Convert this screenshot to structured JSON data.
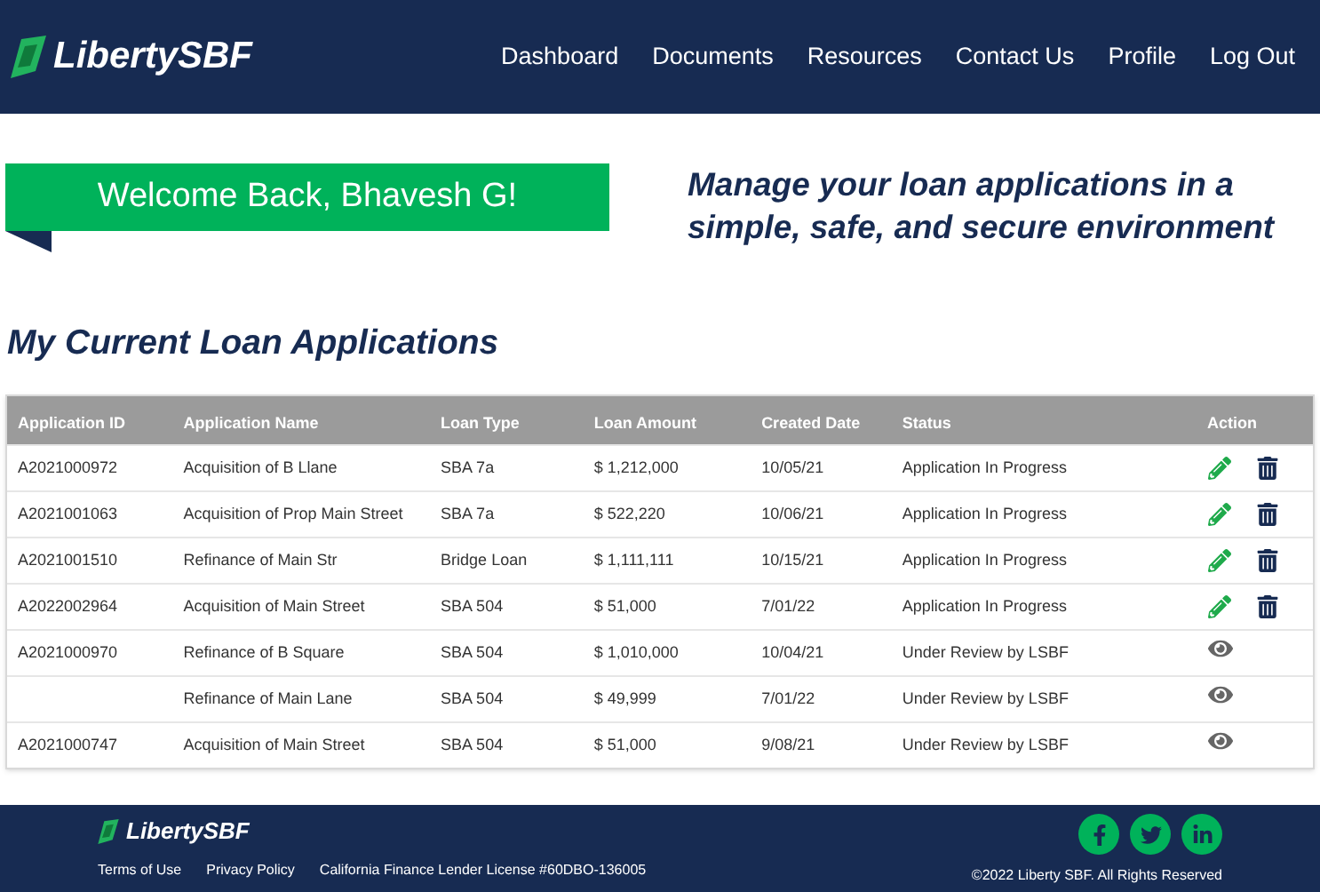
{
  "header": {
    "logo": "LibertySBF",
    "nav": [
      "Dashboard",
      "Documents",
      "Resources",
      "Contact Us",
      "Profile",
      "Log Out"
    ]
  },
  "welcome": "Welcome Back, Bhavesh G!",
  "tagline": "Manage your loan applications in a simple, safe, and secure environment",
  "section_title": "My Current Loan Applications",
  "table": {
    "columns": [
      "Application ID",
      "Application Name",
      "Loan Type",
      "Loan Amount",
      "Created Date",
      "Status",
      "Action"
    ],
    "rows": [
      {
        "id": "A2021000972",
        "name": "Acquisition of B Llane",
        "type": "SBA 7a",
        "amount": "$ 1,212,000",
        "date": "10/05/21",
        "status": "Application In Progress",
        "kind": "editable"
      },
      {
        "id": "A2021001063",
        "name": "Acquisition of Prop Main Street",
        "type": "SBA 7a",
        "amount": "$ 522,220",
        "date": "10/06/21",
        "status": "Application In Progress",
        "kind": "editable"
      },
      {
        "id": "A2021001510",
        "name": "Refinance of Main Str",
        "type": "Bridge Loan",
        "amount": "$ 1,111,111",
        "date": "10/15/21",
        "status": "Application In Progress",
        "kind": "editable"
      },
      {
        "id": "A2022002964",
        "name": "Acquisition of Main Street",
        "type": "SBA 504",
        "amount": "$ 51,000",
        "date": "7/01/22",
        "status": "Application In Progress",
        "kind": "editable"
      },
      {
        "id": "A2021000970",
        "name": "Refinance of B Square",
        "type": "SBA 504",
        "amount": "$ 1,010,000",
        "date": "10/04/21",
        "status": "Under Review by LSBF",
        "kind": "view"
      },
      {
        "name": "Refinance of Main Lane",
        "type": "SBA 504",
        "amount": "$ 49,999",
        "date": "7/01/22",
        "status": "Under Review by LSBF",
        "kind": "view"
      },
      {
        "id": "A2021000747",
        "name": "Acquisition of Main Street",
        "type": "SBA 504",
        "amount": "$ 51,000",
        "date": "9/08/21",
        "status": "Under Review by LSBF",
        "kind": "view"
      }
    ]
  },
  "footer": {
    "logo": "LibertySBF",
    "links": [
      "Terms of Use",
      "Privacy Policy",
      "California Finance Lender License #60DBO-136005"
    ],
    "copyright": "©2022 Liberty SBF. All Rights Reserved"
  }
}
